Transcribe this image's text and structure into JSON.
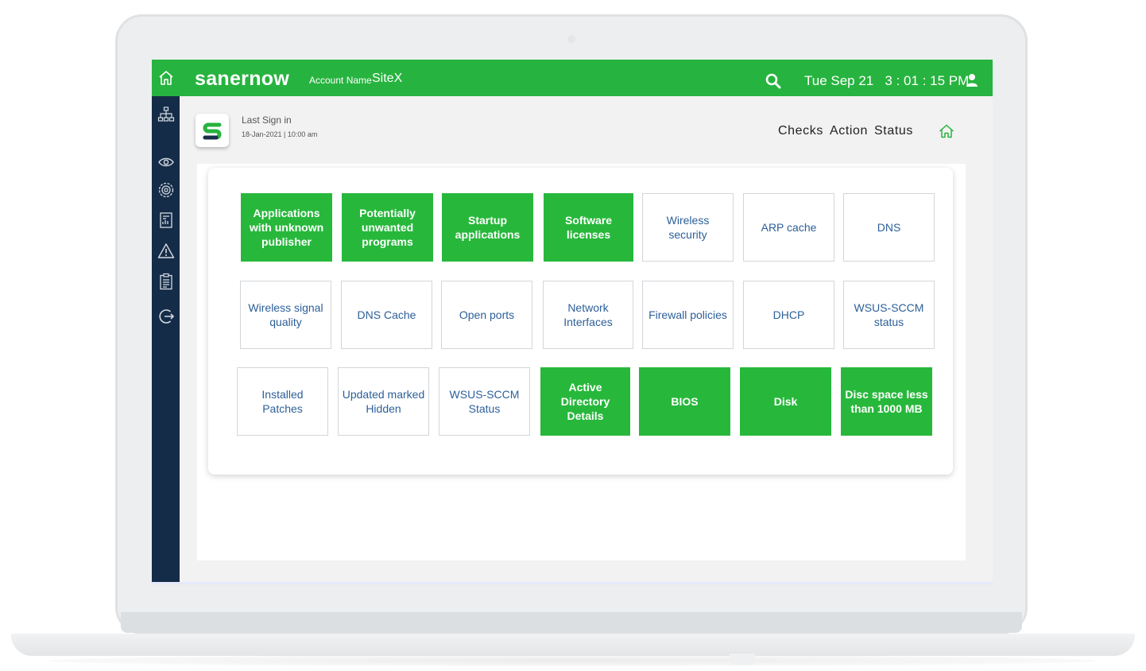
{
  "header": {
    "brand": "sanernow",
    "account_label": "Account Name",
    "account_name": "SiteX",
    "datetime": "Tue Sep 21   3 : 01 : 15 PM"
  },
  "subheader": {
    "last_sign_label": "Last Sign in",
    "last_sign_date": "18-Jan-2021 | 10:00 am",
    "nav": [
      "Checks",
      "Action",
      "Status"
    ]
  },
  "sidebar": {
    "items": [
      "network-icon",
      "eye-icon",
      "settings-icon",
      "report-icon",
      "warning-icon",
      "clipboard-icon",
      "logout-icon"
    ]
  },
  "colors": {
    "accent_green": "#27b33f",
    "sidebar_navy": "#152c48",
    "tile_text_blue": "#2c5f98"
  },
  "tiles": [
    {
      "label": "Applications with unknown publisher",
      "active": true
    },
    {
      "label": "Potentially unwanted programs",
      "active": true
    },
    {
      "label": "Startup applications",
      "active": true
    },
    {
      "label": "Software licenses",
      "active": true
    },
    {
      "label": "Wireless security",
      "active": false
    },
    {
      "label": "ARP cache",
      "active": false
    },
    {
      "label": "DNS",
      "active": false
    },
    {
      "label": "Wireless signal quality",
      "active": false
    },
    {
      "label": "DNS Cache",
      "active": false
    },
    {
      "label": "Open ports",
      "active": false
    },
    {
      "label": "Network Interfaces",
      "active": false
    },
    {
      "label": "Firewall policies",
      "active": false
    },
    {
      "label": "DHCP",
      "active": false
    },
    {
      "label": "WSUS-SCCM status",
      "active": false
    },
    {
      "label": "Installed Patches",
      "active": false
    },
    {
      "label": "Updated marked Hidden",
      "active": false
    },
    {
      "label": "WSUS-SCCM Status",
      "active": false
    },
    {
      "label": "Active Directory Details",
      "active": true
    },
    {
      "label": "BIOS",
      "active": true
    },
    {
      "label": "Disk",
      "active": true
    },
    {
      "label": "Disc space less than 1000 MB",
      "active": true
    }
  ]
}
